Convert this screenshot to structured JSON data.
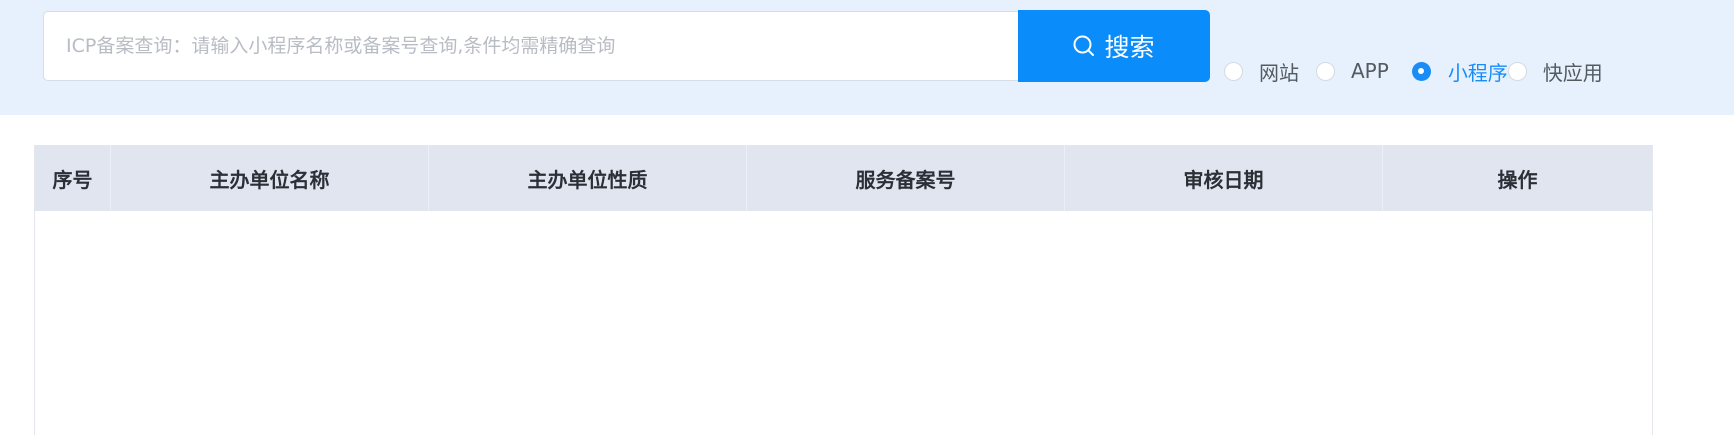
{
  "search": {
    "placeholder": "ICP备案查询：请输入小程序名称或备案号查询,条件均需精确查询",
    "value": "",
    "button_label": "搜索",
    "button_icon": "search-icon"
  },
  "type_filter": {
    "options": [
      {
        "label": "网站",
        "checked": false
      },
      {
        "label": "APP",
        "checked": false
      },
      {
        "label": "小程序",
        "checked": true
      },
      {
        "label": "快应用",
        "checked": false
      }
    ]
  },
  "table": {
    "columns": [
      "序号",
      "主办单位名称",
      "主办单位性质",
      "服务备案号",
      "审核日期",
      "操作"
    ],
    "rows": []
  },
  "colors": {
    "top_bar_bg": "#e6f1fd",
    "accent": "#0a8dfb",
    "header_bg": "#e1e5ef"
  }
}
